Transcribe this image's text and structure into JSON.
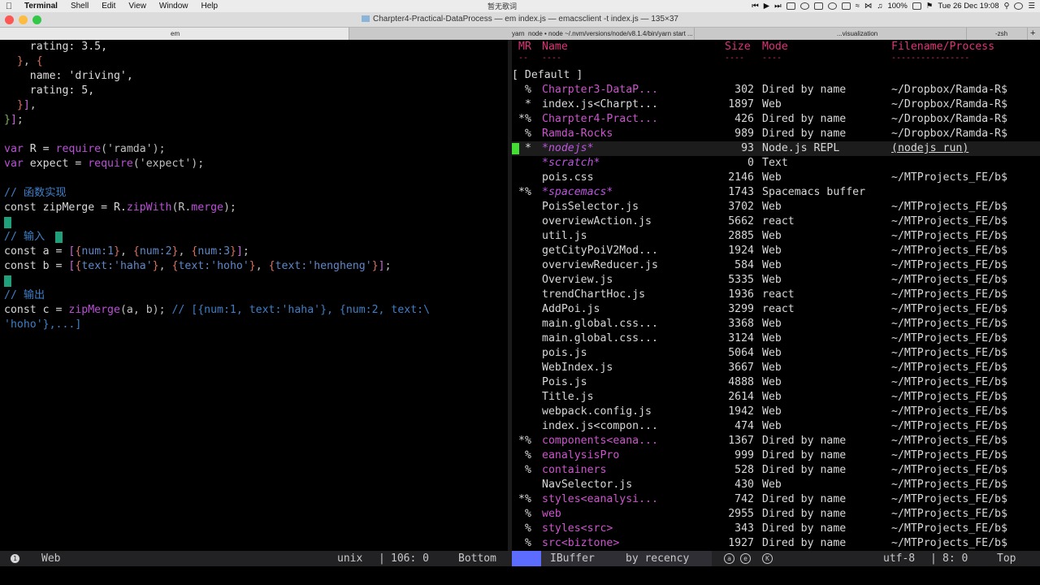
{
  "menubar": {
    "apple_icon": "apple-icon",
    "app_name": "Terminal",
    "menus": [
      "Shell",
      "Edit",
      "View",
      "Window",
      "Help"
    ],
    "center_text": "暂无歌词",
    "battery": "100%",
    "datetime": "Tue 26 Dec  19:08"
  },
  "window": {
    "title": "Charpter4-Practical-DataProcess — em index.js — emacsclient -t index.js — 135×37",
    "traffic_colors": [
      "#fc5753",
      "#fdbc40",
      "#33c748"
    ]
  },
  "tabs": [
    {
      "label": "em",
      "active": true
    },
    {
      "label": "yarn",
      "sub": "node • node ~/.nvm/versions/node/v8.1.4/bin/yarn start ...",
      "active": false
    },
    {
      "label": "...visualization",
      "active": false
    },
    {
      "label": "-zsh",
      "active": false
    }
  ],
  "editor": {
    "lines": [
      [
        [
          "c-str",
          "    rating: 3.5,"
        ]
      ],
      [
        [
          "c-br2",
          "  }"
        ],
        [
          "c-pun",
          ", "
        ],
        [
          "c-br2",
          "{"
        ]
      ],
      [
        [
          "c-str",
          "    name: 'driving',"
        ]
      ],
      [
        [
          "c-str",
          "    rating: 5,"
        ]
      ],
      [
        [
          "c-br2",
          "  }"
        ],
        [
          "c-br1",
          "]"
        ],
        [
          "c-pun",
          ","
        ]
      ],
      [
        [
          "c-br3",
          "}"
        ],
        [
          "c-br1",
          "]"
        ],
        [
          "c-pun",
          ";"
        ]
      ],
      [
        [
          "c-pun",
          ""
        ]
      ],
      [
        [
          "c-kw",
          "var"
        ],
        [
          "c-fn",
          " R = "
        ],
        [
          "c-kw",
          "require"
        ],
        [
          "c-pun",
          "('ramda');"
        ]
      ],
      [
        [
          "c-kw",
          "var"
        ],
        [
          "c-fn",
          " expect = "
        ],
        [
          "c-kw",
          "require"
        ],
        [
          "c-pun",
          "('expect');"
        ]
      ],
      [
        [
          "c-pun",
          ""
        ]
      ],
      [
        [
          "c-cmt",
          "// 函数实现"
        ]
      ],
      [
        [
          "c-fn",
          "const zipMerge = R."
        ],
        [
          "c-kw",
          "zipWith"
        ],
        [
          "c-pun",
          "(R."
        ],
        [
          "c-kw",
          "merge"
        ],
        [
          "c-pun",
          ");"
        ]
      ],
      [
        [
          "c-pun",
          ""
        ]
      ],
      [
        [
          "c-cmt",
          "// 输入"
        ]
      ],
      [
        [
          "c-fn",
          "const a = "
        ],
        [
          "c-br1",
          "["
        ],
        [
          "c-br2",
          "{"
        ],
        [
          "c-dim",
          "num:1"
        ],
        [
          "c-br2",
          "}"
        ],
        [
          "c-pun",
          ", "
        ],
        [
          "c-br2",
          "{"
        ],
        [
          "c-dim",
          "num:2"
        ],
        [
          "c-br2",
          "}"
        ],
        [
          "c-pun",
          ", "
        ],
        [
          "c-br2",
          "{"
        ],
        [
          "c-dim",
          "num:3"
        ],
        [
          "c-br2",
          "}"
        ],
        [
          "c-br1",
          "]"
        ],
        [
          "c-pun",
          ";"
        ]
      ],
      [
        [
          "c-fn",
          "const b = "
        ],
        [
          "c-br1",
          "["
        ],
        [
          "c-br2",
          "{"
        ],
        [
          "c-dim",
          "text:'haha'"
        ],
        [
          "c-br2",
          "}"
        ],
        [
          "c-pun",
          ", "
        ],
        [
          "c-br2",
          "{"
        ],
        [
          "c-dim",
          "text:'hoho'"
        ],
        [
          "c-br2",
          "}"
        ],
        [
          "c-pun",
          ", "
        ],
        [
          "c-br2",
          "{"
        ],
        [
          "c-dim",
          "text:'hengheng'"
        ],
        [
          "c-br2",
          "}"
        ],
        [
          "c-br1",
          "]"
        ],
        [
          "c-pun",
          ";"
        ]
      ],
      [
        [
          "c-pun",
          ""
        ]
      ],
      [
        [
          "c-cmt",
          "// 输出"
        ]
      ],
      [
        [
          "c-fn",
          "const c = "
        ],
        [
          "c-kw",
          "zipMerge"
        ],
        [
          "c-pun",
          "(a, b); "
        ],
        [
          "c-cmt",
          "// [{num:1, text:'haha'}, {num:2, text:\\"
        ]
      ],
      [
        [
          "c-cmt",
          "'hoho'},...]"
        ]
      ]
    ]
  },
  "ibuffer": {
    "headers": {
      "mr": "MR",
      "name": "Name",
      "size": "Size",
      "mode": "Mode",
      "filename": "Filename/Process"
    },
    "header_dashes": {
      "mr": "-- ",
      "name": "----",
      "size": "----",
      "mode": "----",
      "filename": "----------------"
    },
    "group": "[ Default ]",
    "rows": [
      {
        "mark": " %",
        "name": "Charpter3-DataP...",
        "size": "302",
        "mode": "Dired by name",
        "file": "~/Dropbox/Ramda-R$",
        "kind": "dir"
      },
      {
        "mark": " *",
        "name": "index.js<Charpt...",
        "size": "1897",
        "mode": "Web",
        "file": "~/Dropbox/Ramda-R$",
        "kind": "file"
      },
      {
        "mark": "*%",
        "name": "Charpter4-Pract...",
        "size": "426",
        "mode": "Dired by name",
        "file": "~/Dropbox/Ramda-R$",
        "kind": "dir"
      },
      {
        "mark": " %",
        "name": "Ramda-Rocks",
        "size": "989",
        "mode": "Dired by name",
        "file": "~/Dropbox/Ramda-R$",
        "kind": "dir"
      },
      {
        "mark": " *",
        "name": "*nodejs*",
        "size": "93",
        "mode": "Node.js REPL",
        "file": "(nodejs run)",
        "kind": "special",
        "current": true
      },
      {
        "mark": "  ",
        "name": "*scratch*",
        "size": "0",
        "mode": "Text",
        "file": "",
        "kind": "special"
      },
      {
        "mark": "  ",
        "name": "pois.css",
        "size": "2146",
        "mode": "Web",
        "file": "~/MTProjects_FE/b$",
        "kind": "file"
      },
      {
        "mark": "*%",
        "name": "*spacemacs*",
        "size": "1743",
        "mode": "Spacemacs buffer",
        "file": "",
        "kind": "special"
      },
      {
        "mark": "  ",
        "name": "PoisSelector.js",
        "size": "3702",
        "mode": "Web",
        "file": "~/MTProjects_FE/b$",
        "kind": "file"
      },
      {
        "mark": "  ",
        "name": "overviewAction.js",
        "size": "5662",
        "mode": "react",
        "file": "~/MTProjects_FE/b$",
        "kind": "file"
      },
      {
        "mark": "  ",
        "name": "util.js",
        "size": "2885",
        "mode": "Web",
        "file": "~/MTProjects_FE/b$",
        "kind": "file"
      },
      {
        "mark": "  ",
        "name": "getCityPoiV2Mod...",
        "size": "1924",
        "mode": "Web",
        "file": "~/MTProjects_FE/b$",
        "kind": "file"
      },
      {
        "mark": "  ",
        "name": "overviewReducer.js",
        "size": "584",
        "mode": "Web",
        "file": "~/MTProjects_FE/b$",
        "kind": "file"
      },
      {
        "mark": "  ",
        "name": "Overview.js",
        "size": "5335",
        "mode": "Web",
        "file": "~/MTProjects_FE/b$",
        "kind": "file"
      },
      {
        "mark": "  ",
        "name": "trendChartHoc.js",
        "size": "1936",
        "mode": "react",
        "file": "~/MTProjects_FE/b$",
        "kind": "file"
      },
      {
        "mark": "  ",
        "name": "AddPoi.js",
        "size": "3299",
        "mode": "react",
        "file": "~/MTProjects_FE/b$",
        "kind": "file"
      },
      {
        "mark": "  ",
        "name": "main.global.css...",
        "size": "3368",
        "mode": "Web",
        "file": "~/MTProjects_FE/b$",
        "kind": "file"
      },
      {
        "mark": "  ",
        "name": "main.global.css...",
        "size": "3124",
        "mode": "Web",
        "file": "~/MTProjects_FE/b$",
        "kind": "file"
      },
      {
        "mark": "  ",
        "name": "pois.js",
        "size": "5064",
        "mode": "Web",
        "file": "~/MTProjects_FE/b$",
        "kind": "file"
      },
      {
        "mark": "  ",
        "name": "WebIndex.js",
        "size": "3667",
        "mode": "Web",
        "file": "~/MTProjects_FE/b$",
        "kind": "file"
      },
      {
        "mark": "  ",
        "name": "Pois.js",
        "size": "4888",
        "mode": "Web",
        "file": "~/MTProjects_FE/b$",
        "kind": "file"
      },
      {
        "mark": "  ",
        "name": "Title.js",
        "size": "2614",
        "mode": "Web",
        "file": "~/MTProjects_FE/b$",
        "kind": "file"
      },
      {
        "mark": "  ",
        "name": "webpack.config.js",
        "size": "1942",
        "mode": "Web",
        "file": "~/MTProjects_FE/b$",
        "kind": "file"
      },
      {
        "mark": "  ",
        "name": "index.js<compon...",
        "size": "474",
        "mode": "Web",
        "file": "~/MTProjects_FE/b$",
        "kind": "file"
      },
      {
        "mark": "*%",
        "name": "components<eana...",
        "size": "1367",
        "mode": "Dired by name",
        "file": "~/MTProjects_FE/b$",
        "kind": "dir"
      },
      {
        "mark": " %",
        "name": "eanalysisPro",
        "size": "999",
        "mode": "Dired by name",
        "file": "~/MTProjects_FE/b$",
        "kind": "dir"
      },
      {
        "mark": " %",
        "name": "containers",
        "size": "528",
        "mode": "Dired by name",
        "file": "~/MTProjects_FE/b$",
        "kind": "dir"
      },
      {
        "mark": "  ",
        "name": "NavSelector.js",
        "size": "430",
        "mode": "Web",
        "file": "~/MTProjects_FE/b$",
        "kind": "file"
      },
      {
        "mark": "*%",
        "name": "styles<eanalysi...",
        "size": "742",
        "mode": "Dired by name",
        "file": "~/MTProjects_FE/b$",
        "kind": "dir"
      },
      {
        "mark": " %",
        "name": "web",
        "size": "2955",
        "mode": "Dired by name",
        "file": "~/MTProjects_FE/b$",
        "kind": "dir"
      },
      {
        "mark": " %",
        "name": "styles<src>",
        "size": "343",
        "mode": "Dired by name",
        "file": "~/MTProjects_FE/b$",
        "kind": "dir"
      },
      {
        "mark": " %",
        "name": "src<biztone>",
        "size": "1927",
        "mode": "Dired by name",
        "file": "~/MTProjects_FE/b$",
        "kind": "dir"
      }
    ]
  },
  "modeline": {
    "left_num": "1",
    "left_mode": "Web",
    "left_encoding": "unix",
    "left_pos": "106: 0",
    "left_scroll": "Bottom",
    "right_buffer": "IBuffer",
    "right_sort": "by recency",
    "right_encoding": "utf-8",
    "right_pos": "8: 0",
    "right_scroll": "Top",
    "sep": "|"
  },
  "colors": {
    "keyword": "#bc4fd8",
    "comment": "#3f7fc6",
    "header": "#dd3377",
    "dired": "#cc55cc",
    "cursor": "#44dd33",
    "modeline_accent": "#5b6cff"
  }
}
